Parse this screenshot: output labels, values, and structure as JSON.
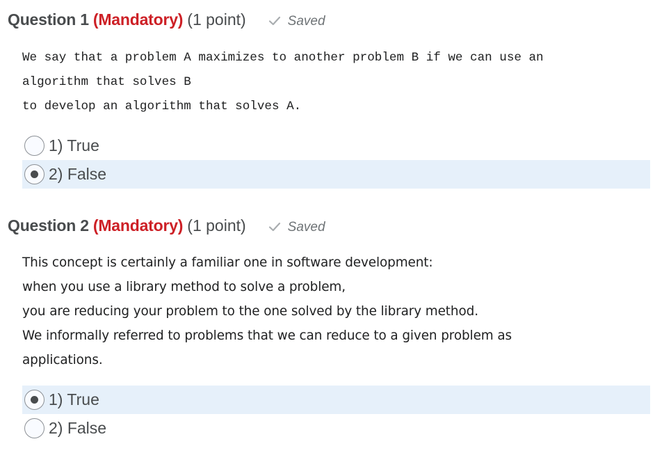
{
  "questions": [
    {
      "title": "Question 1",
      "mandatory": "(Mandatory)",
      "points": "(1 point)",
      "status": "Saved",
      "status_icon": "check-icon",
      "body_style": "monospace",
      "body_lines": [
        "We say that a problem A maximizes to another problem B if we can use an",
        "algorithm that solves B",
        "to develop an algorithm that solves A."
      ],
      "options": [
        {
          "label": "1) True",
          "selected": false
        },
        {
          "label": "2) False",
          "selected": true
        }
      ]
    },
    {
      "title": "Question 2",
      "mandatory": "(Mandatory)",
      "points": "(1 point)",
      "status": "Saved",
      "status_icon": "check-icon",
      "body_style": "sans",
      "body_lines": [
        "This concept is certainly a familiar one in software development:",
        "when you use a library method to solve a problem,",
        "you are reducing your problem to the one solved by the library method.",
        "We informally referred to problems that we can reduce to a given problem as",
        "applications."
      ],
      "options": [
        {
          "label": "1) True",
          "selected": true
        },
        {
          "label": "2) False",
          "selected": false
        }
      ]
    }
  ],
  "colors": {
    "mandatory": "#cd2026",
    "selected_bg": "#e6f0fa",
    "text": "#494c4e"
  }
}
